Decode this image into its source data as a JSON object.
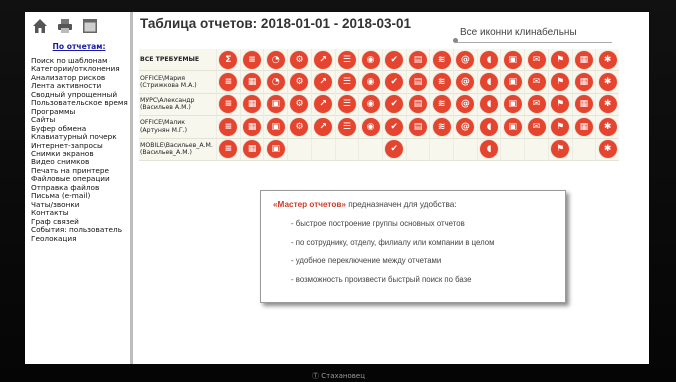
{
  "header": {
    "title": "Таблица отчетов: 2018-01-01 - 2018-03-01"
  },
  "search": {
    "value": "Все иконни клинабельны"
  },
  "sidebar": {
    "title": "По отчетам:",
    "items": [
      "Поиск по шаблонам",
      "Категории/отклонения",
      "Анализатор рисков",
      "Лента активности",
      "Сводный упрощенный",
      "Пользовательское время",
      "Программы",
      "Сайты",
      "Буфер обмена",
      "Клавиатурный почерк",
      "Интернет-запросы",
      "Снимки экранов",
      "Видео снимков",
      "Печать на принтере",
      "Файловые операции",
      "Отправка файлов",
      "Письма (e-mail)",
      "Чаты/звонки",
      "Контакты",
      "Граф связей",
      "События: пользователь",
      "Геолокация"
    ]
  },
  "report_table": {
    "rows": [
      {
        "line1": "ВСЕ ТРЕБУЕМЫЕ",
        "line2": "",
        "header": true,
        "cells": [
          "Σ",
          "≡",
          "◔",
          "⚙",
          "↗",
          "☰",
          "◉",
          "✔",
          "▤",
          "≋",
          "@",
          "◖",
          "▣",
          "✉",
          "⚑",
          "▦",
          "✱"
        ]
      },
      {
        "line1": "OFFICE\\Мария",
        "line2": "(Стрижкова М.А.)",
        "header": false,
        "cells": [
          "≡",
          "▦",
          "◔",
          "⚙",
          "↗",
          "☰",
          "◉",
          "✔",
          "▤",
          "≋",
          "@",
          "◖",
          "▣",
          "✉",
          "⚑",
          "▦",
          "✱"
        ]
      },
      {
        "line1": "МУРС\\Александр",
        "line2": "(Васильев А.М.)",
        "header": false,
        "cells": [
          "≡",
          "▦",
          "▣",
          "⚙",
          "↗",
          "☰",
          "◉",
          "✔",
          "▤",
          "≋",
          "@",
          "◖",
          "▣",
          "✉",
          "⚑",
          "▦",
          "✱"
        ]
      },
      {
        "line1": "OFFICE\\Малик",
        "line2": "(Артунян М.Г.)",
        "header": false,
        "cells": [
          "≡",
          "▦",
          "▣",
          "⚙",
          "↗",
          "☰",
          "◉",
          "✔",
          "▤",
          "≋",
          "@",
          "◖",
          "▣",
          "✉",
          "⚑",
          "▦",
          "✱"
        ]
      },
      {
        "line1": "MOBILE\\Васильев_А.М.",
        "line2": "(Васильев_А.М.)",
        "header": false,
        "cells": [
          "≡",
          "▦",
          "▣",
          "",
          "",
          "",
          "",
          "✔",
          "",
          "",
          "",
          "◖",
          "",
          "",
          "⚑",
          "",
          "✱"
        ]
      }
    ]
  },
  "info_box": {
    "highlight": "«Мастер отчетов»",
    "intro": " предназначен для удобства:",
    "items": [
      "- быстрое построение группы основных отчетов",
      "- по сотруднику, отделу, филиалу или компании в целом",
      "- удобное переключение между отчетами",
      "- возможность произвести быстрый поиск по базе"
    ]
  },
  "watermark": "Стахановец",
  "colors": {
    "accent": "#e5442f",
    "table_bg": "#f7f7ee",
    "sidebar_link": "#1a1aa8"
  },
  "icons": {
    "toolbar": [
      "home-icon",
      "printer-icon",
      "window-icon"
    ]
  }
}
